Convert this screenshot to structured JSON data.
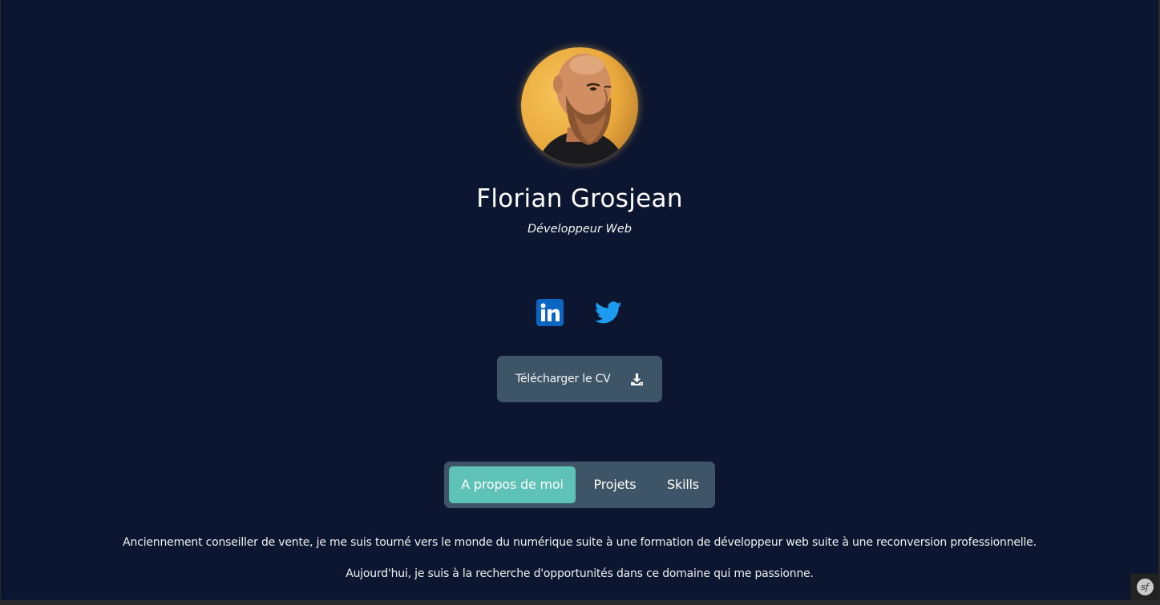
{
  "profile": {
    "name": "Florian Grosjean",
    "role": "Développeur Web",
    "avatar_icon": "profile-photo"
  },
  "social": {
    "linkedin_icon": "linkedin-icon",
    "twitter_icon": "twitter-icon",
    "linkedin_color": "#0a66c2",
    "twitter_color": "#1d9bf0"
  },
  "cv_button": {
    "label": "Télécharger le CV",
    "icon": "download-icon"
  },
  "tabs": [
    {
      "label": "A propos de moi",
      "active": true
    },
    {
      "label": "Projets",
      "active": false
    },
    {
      "label": "Skills",
      "active": false
    }
  ],
  "about": {
    "paragraph_1": "Anciennement conseiller de vente, je me suis tourné vers le monde du numérique suite à une formation de développeur web suite à une reconversion professionnelle.",
    "paragraph_2": "Aujourd'hui, je suis à la recherche d'opportunités dans ce domaine qui me passionne."
  },
  "debug_toolbar": {
    "logo_text": "sf"
  },
  "colors": {
    "background": "#0c1630",
    "panel": "#3e5568",
    "accent": "#5ec2b7"
  }
}
